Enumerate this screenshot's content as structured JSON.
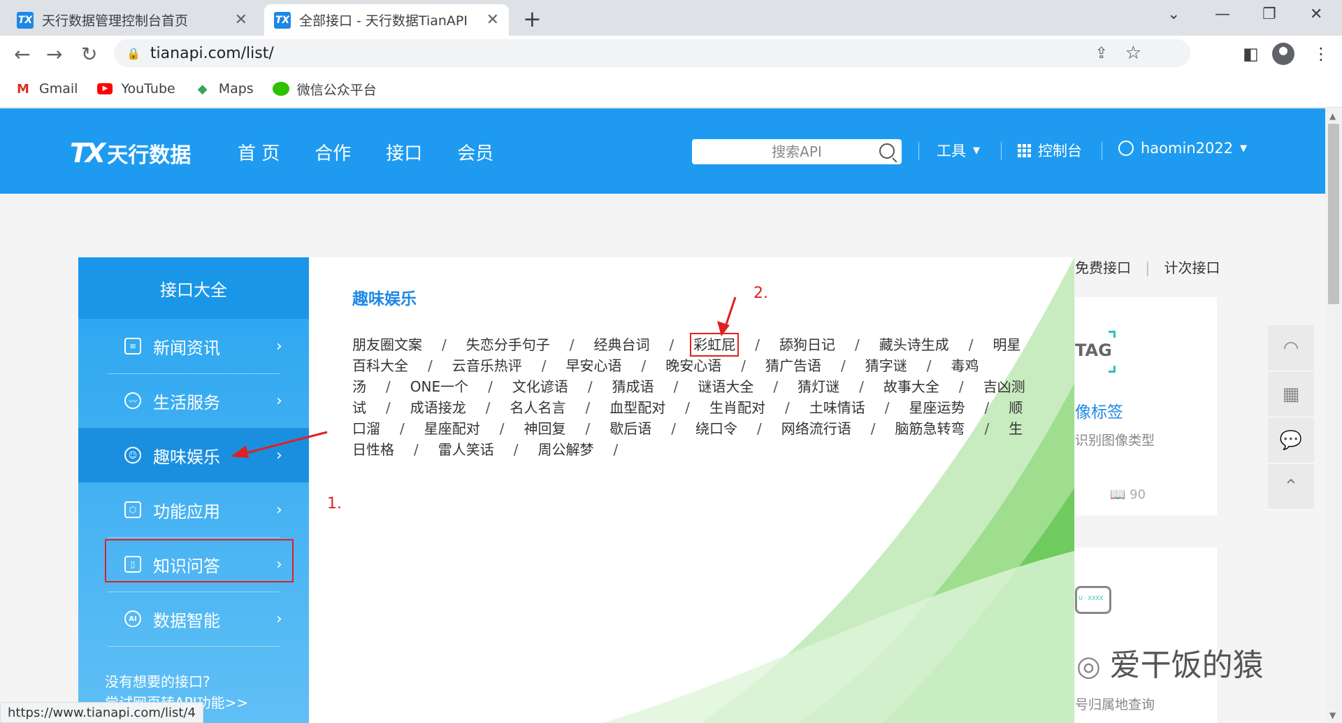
{
  "browser": {
    "tabs": [
      {
        "title": "天行数据管理控制台首页",
        "active": false
      },
      {
        "title": "全部接口 - 天行数据TianAPI",
        "active": true
      }
    ],
    "url": "tianapi.com/list/",
    "bookmarks": [
      {
        "label": "Gmail",
        "icon": "gmail-icon"
      },
      {
        "label": "YouTube",
        "icon": "youtube-icon"
      },
      {
        "label": "Maps",
        "icon": "maps-icon"
      },
      {
        "label": "微信公众平台",
        "icon": "wechat-icon"
      }
    ],
    "status_url": "https://www.tianapi.com/list/4"
  },
  "header": {
    "logo_mark": "TX",
    "logo_text": "天行数据",
    "nav": [
      "首 页",
      "合作",
      "接口",
      "会员"
    ],
    "search_placeholder": "搜索API",
    "tools": "工具",
    "console": "控制台",
    "username": "haomin2022"
  },
  "sidebar": {
    "title": "接口大全",
    "items": [
      {
        "label": "新闻资讯",
        "icon": "news-icon"
      },
      {
        "label": "生活服务",
        "icon": "bowl-icon"
      },
      {
        "label": "趣味娱乐",
        "icon": "smile-icon"
      },
      {
        "label": "功能应用",
        "icon": "cube-icon"
      },
      {
        "label": "知识问答",
        "icon": "book-icon"
      },
      {
        "label": "数据智能",
        "icon": "ai-icon"
      }
    ],
    "active_index": 2,
    "footer_line1": "没有想要的接口?",
    "footer_line2": "尝试网页转API功能>>"
  },
  "content": {
    "category_title": "趣味娱乐",
    "apis": [
      "朋友圈文案",
      "失恋分手句子",
      "经典台词",
      "彩虹屁",
      "舔狗日记",
      "藏头诗生成",
      "明星百科大全",
      "云音乐热评",
      "早安心语",
      "晚安心语",
      "猜广告语",
      "猜字谜",
      "毒鸡汤",
      "ONE一个",
      "文化谚语",
      "猜成语",
      "谜语大全",
      "猜灯谜",
      "故事大全",
      "吉凶测试",
      "成语接龙",
      "名人名言",
      "血型配对",
      "生肖配对",
      "土味情话",
      "星座运势",
      "顺口溜",
      "星座配对",
      "神回复",
      "歇后语",
      "绕口令",
      "网络流行语",
      "脑筋急转弯",
      "生日性格",
      "雷人笑话",
      "周公解梦"
    ],
    "highlighted": "彩虹屁",
    "annotation_1": "1.",
    "annotation_2": "2."
  },
  "right": {
    "tab_free": "免费接口",
    "tab_sep": "|",
    "tab_paid": "计次接口",
    "card1_badge": "TAG",
    "card1_title": "像标签",
    "card1_desc": "识别图像类型",
    "card1_views": "90",
    "card2_badge": "U · XXXX",
    "card2_desc": "号归属地查询",
    "watermark": "爱干饭的猿"
  },
  "colors": {
    "header_blue": "#1e9bf0",
    "link_blue": "#1e88e5",
    "annotation_red": "#e02020"
  }
}
